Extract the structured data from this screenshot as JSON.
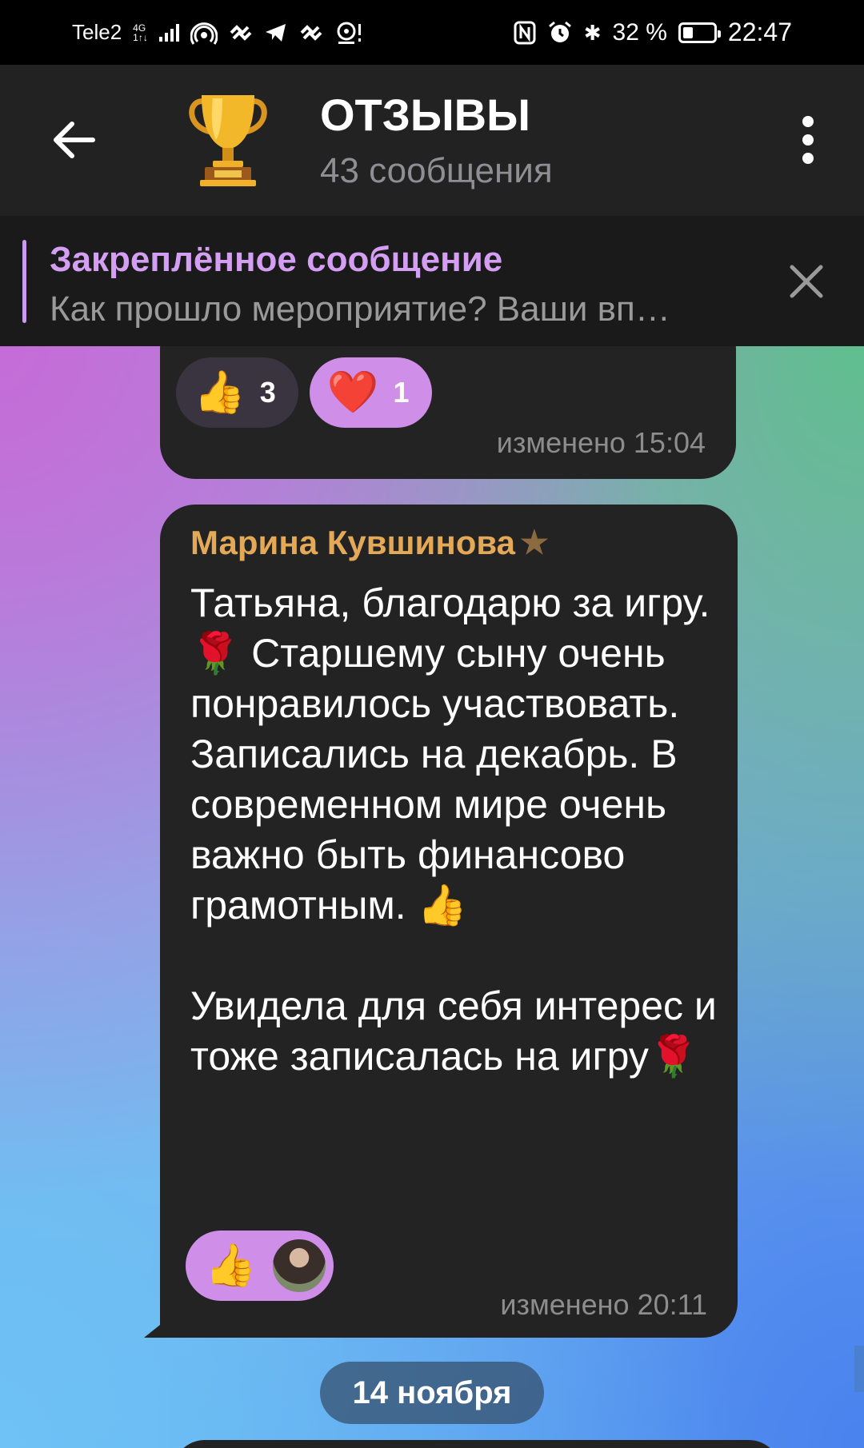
{
  "status_bar": {
    "carrier": "Tele2",
    "net_top": "4G",
    "net_bottom": "1↑↓",
    "battery_percent": "32 %",
    "battery_level": 0.32,
    "time": "22:47"
  },
  "header": {
    "title": "ОТЗЫВЫ",
    "subtitle": "43 сообщения",
    "avatar_icon": "trophy-icon"
  },
  "pinned": {
    "title": "Закреплённое сообщение",
    "text": "Как прошло мероприятие? Ваши вп…"
  },
  "messages": [
    {
      "reactions": [
        {
          "emoji": "👍",
          "count": "3"
        },
        {
          "emoji": "❤️",
          "count": "1"
        }
      ],
      "edited_time": "изменено 15:04"
    },
    {
      "sender": "Марина Кувшинова",
      "sender_badge": "★",
      "text": "Татьяна, благодарю за игру.🌹 Старшему сыну очень понравилось участвовать. Записались на декабрь. В современном мире очень важно быть финансово грамотным. 👍\n\nУвидела для себя интерес и тоже записалась на игру🌹",
      "reaction_emoji": "👍",
      "edited_time": "изменено 20:11"
    }
  ],
  "date_separator": "14 ноября",
  "colors": {
    "accent_purple": "#d49ef3",
    "sender_name": "#e3a957",
    "bubble_bg": "#232323"
  }
}
